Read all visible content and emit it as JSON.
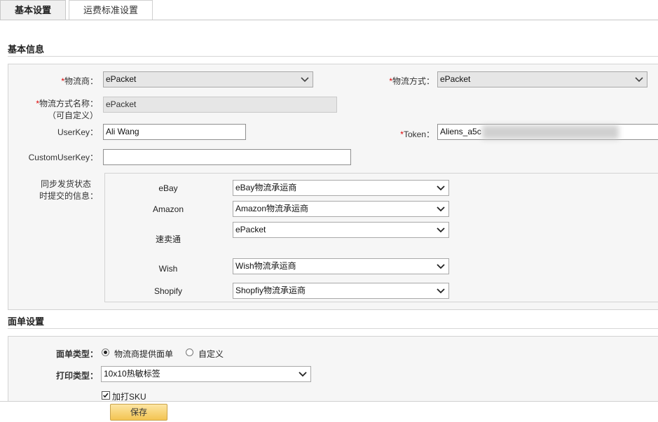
{
  "tabs": [
    {
      "label": "基本设置",
      "active": true
    },
    {
      "label": "运费标准设置",
      "active": false
    }
  ],
  "basic": {
    "section_title": "基本信息",
    "carrier": {
      "required_mark": "*",
      "label": "物流商：",
      "value": "ePacket"
    },
    "method": {
      "required_mark": "*",
      "label": "物流方式：",
      "value": "ePacket"
    },
    "method_name": {
      "required_mark": "*",
      "label_line1": "物流方式名称：",
      "label_line2": "（可自定义）",
      "value": "ePacket"
    },
    "userkey": {
      "label": "UserKey：",
      "value": "Ali Wang"
    },
    "token": {
      "required_mark": "*",
      "label": "Token：",
      "value": "Aliens_a5c"
    },
    "customuserkey": {
      "label": "CustomUserKey：",
      "value": ""
    },
    "sync": {
      "label_line1": "同步发货状态",
      "label_line2": "时提交的信息：",
      "platforms": [
        {
          "name": "eBay",
          "value": "eBay物流承运商"
        },
        {
          "name": "Amazon",
          "value": "Amazon物流承运商"
        },
        {
          "name": "速卖通",
          "value": "ePacket"
        },
        {
          "name": "Wish",
          "value": "Wish物流承运商"
        },
        {
          "name": "Shopify",
          "value": "Shopfiy物流承运商"
        }
      ]
    }
  },
  "label_settings": {
    "section_title": "面单设置",
    "label_type": {
      "label": "面单类型：",
      "options": [
        "物流商提供面单",
        "自定义"
      ],
      "selected": "物流商提供面单"
    },
    "print_type": {
      "label": "打印类型：",
      "value": "10x10热敏标签"
    },
    "print_sku": {
      "label": "加打SKU",
      "checked": true
    }
  },
  "footer": {
    "save_label": "保存"
  }
}
